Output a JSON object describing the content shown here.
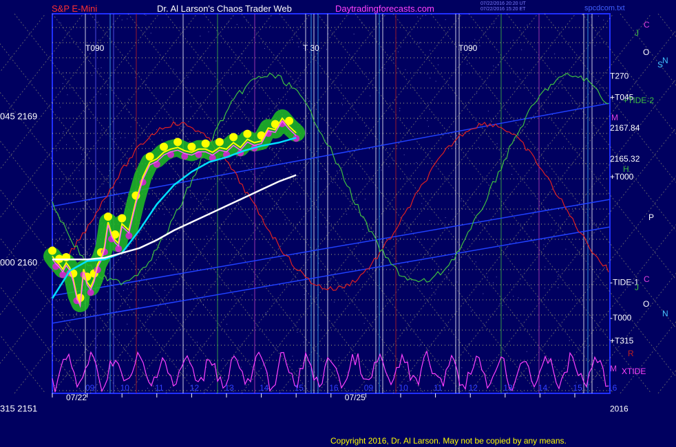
{
  "header": {
    "symbol": "S&P E-Mini",
    "title": "Dr. Al Larson's Chaos Trader Web",
    "site": "Daytradingforecasts.com",
    "timestamp1": "07/22/2016 20:20 UT",
    "timestamp2": "07/22/2016 15:20 ET",
    "file": "spcdcom.txt"
  },
  "footer": {
    "copyright": "Copyright 2016, Dr. Al Larson. May not be copied by any means."
  },
  "colors": {
    "background": "#000060",
    "frame": "#2030ff",
    "grid_yellow": "#ffff80",
    "price": "#ffff00",
    "glow": "#20c020",
    "tide": "#00e0ff",
    "trend": "#ffffff",
    "red_curve": "#e02020",
    "green_curve": "#40c040",
    "xtide": "#ff40ff"
  },
  "chart_data": {
    "type": "line",
    "title": "S&P E-Mini",
    "ylim": [
      2151,
      2172
    ],
    "y_ticks": [
      {
        "value": 2169,
        "label": "045  2169"
      },
      {
        "value": 2160,
        "label": "000  2160"
      },
      {
        "value": 2151,
        "label": "315  2151"
      }
    ],
    "x_ticks": [
      {
        "x": 0,
        "label": "09"
      },
      {
        "x": 1,
        "label": "10"
      },
      {
        "x": 2,
        "label": "11"
      },
      {
        "x": 3,
        "label": "12"
      },
      {
        "x": 4,
        "label": "13"
      },
      {
        "x": 5,
        "label": "14"
      },
      {
        "x": 6,
        "label": "15"
      },
      {
        "x": 7,
        "label": "16"
      },
      {
        "x": 8,
        "label": "09"
      },
      {
        "x": 9,
        "label": "10"
      },
      {
        "x": 10,
        "label": "11"
      },
      {
        "x": 11,
        "label": "12"
      },
      {
        "x": 12,
        "label": "13"
      },
      {
        "x": 13,
        "label": "14"
      },
      {
        "x": 14,
        "label": "15"
      },
      {
        "x": 15,
        "label": "16"
      }
    ],
    "date_labels": [
      {
        "x": 0,
        "label": "07/22"
      },
      {
        "x": 8,
        "label": "07/25"
      }
    ],
    "right_labels": [
      {
        "value": 2171.5,
        "label": "T270"
      },
      {
        "value": 2170.2,
        "label": "+T045"
      },
      {
        "value": 2168.3,
        "label": "2167.84"
      },
      {
        "value": 2166.4,
        "label": "2165.32"
      },
      {
        "value": 2165.3,
        "label": "+T000"
      },
      {
        "value": 2158.8,
        "label": "-TIDE-1"
      },
      {
        "value": 2156.6,
        "label": "-T000"
      },
      {
        "value": 2155.2,
        "label": "+T315"
      },
      {
        "value": 2151.0,
        "label": "2016"
      }
    ],
    "series": [
      {
        "name": "S&P E-Mini",
        "x": [
          0,
          0.1,
          0.2,
          0.3,
          0.4,
          0.5,
          0.6,
          0.7,
          0.8,
          0.9,
          1.0,
          1.1,
          1.2,
          1.3,
          1.4,
          1.5,
          1.6,
          1.7,
          1.8,
          1.9,
          2.0,
          2.2,
          2.4,
          2.6,
          2.8,
          3.0,
          3.2,
          3.4,
          3.6,
          3.8,
          4.0,
          4.2,
          4.4,
          4.6,
          4.8,
          5.0,
          5.2,
          5.4,
          5.6,
          5.8,
          6.0,
          6.2,
          6.4,
          6.6,
          6.8,
          7.0
        ],
        "values": [
          2160.4,
          2160.1,
          2159.9,
          2159.6,
          2160.0,
          2159.7,
          2159.0,
          2158.0,
          2157.5,
          2159.6,
          2158.8,
          2158.5,
          2159.0,
          2159.9,
          2160.3,
          2161.0,
          2162.5,
          2161.8,
          2161.4,
          2161.2,
          2162.4,
          2162.0,
          2163.8,
          2165.3,
          2166.2,
          2166.4,
          2166.8,
          2167.0,
          2167.1,
          2166.9,
          2166.8,
          2167.0,
          2167.0,
          2166.8,
          2167.1,
          2167.0,
          2167.4,
          2167.1,
          2167.6,
          2167.4,
          2167.5,
          2168.3,
          2168.2,
          2168.9,
          2168.4,
          2168.0
        ]
      },
      {
        "name": "",
        "x": [
          0,
          0.5,
          1.0,
          1.5,
          2.0,
          2.5,
          3.0,
          3.5,
          4.0,
          4.5,
          5.0,
          5.5,
          6.0,
          6.5,
          7.0
        ],
        "values": [
          2157.8,
          2159.5,
          2160.1,
          2160.2,
          2160.6,
          2162.0,
          2163.6,
          2164.8,
          2165.6,
          2166.2,
          2166.5,
          2166.9,
          2167.2,
          2167.4,
          2167.7
        ]
      },
      {
        "name": "",
        "x": [
          0,
          0.5,
          1.0,
          1.5,
          2.0,
          2.5,
          3.0,
          3.5,
          4.0,
          4.5,
          5.0,
          5.5,
          6.0,
          6.5,
          7.0
        ],
        "values": [
          2160.2,
          2160.2,
          2160.2,
          2160.3,
          2160.6,
          2160.9,
          2161.4,
          2162.0,
          2162.5,
          2163.0,
          2163.5,
          2164.0,
          2164.5,
          2165.0,
          2165.4
        ]
      }
    ]
  }
}
